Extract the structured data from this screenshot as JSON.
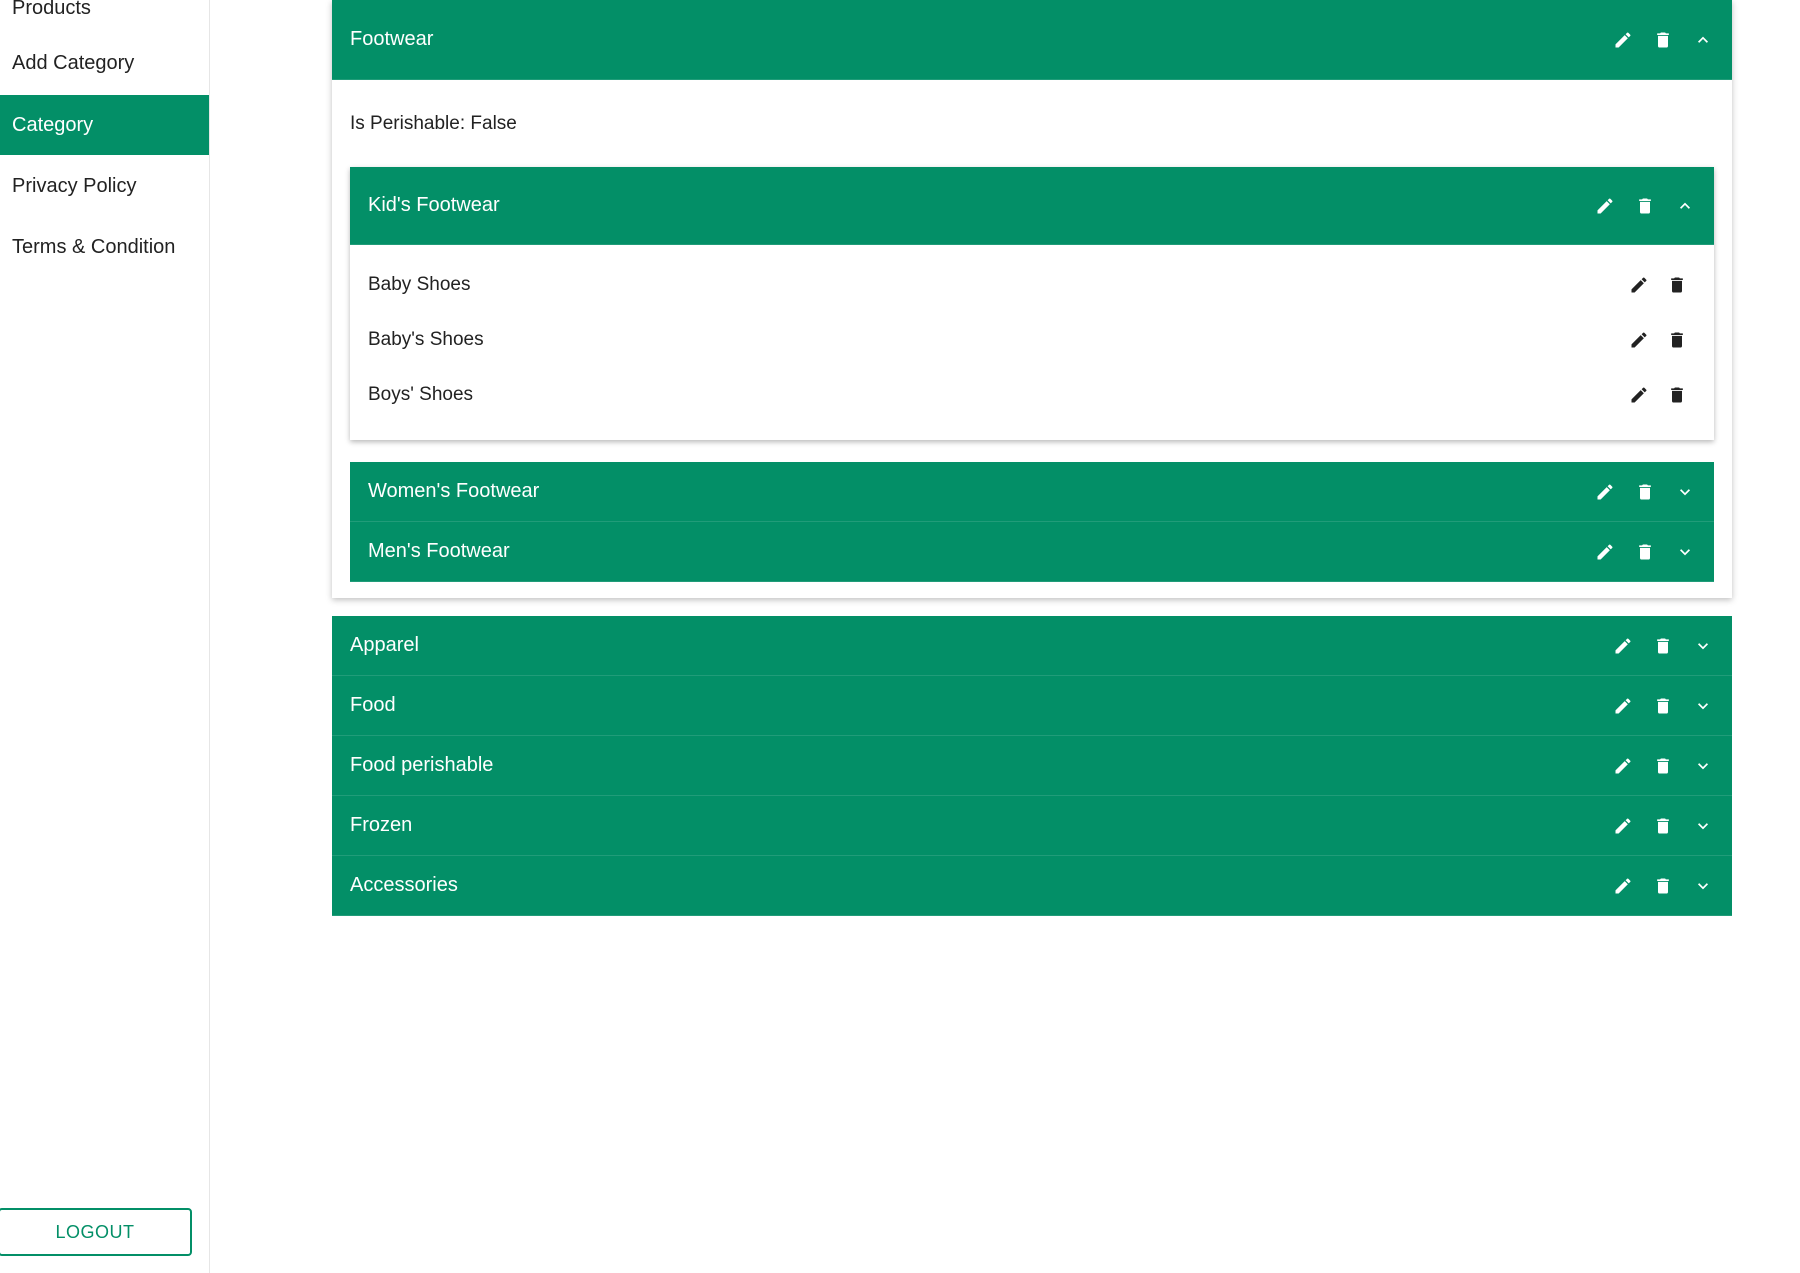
{
  "sidebar": {
    "items": [
      {
        "label": "Products",
        "active": false
      },
      {
        "label": "Add Category",
        "active": false
      },
      {
        "label": "Category",
        "active": true
      },
      {
        "label": "Privacy Policy",
        "active": false
      },
      {
        "label": "Terms & Condition",
        "active": false
      }
    ],
    "logout_label": "LOGOUT"
  },
  "categories": [
    {
      "name": "Footwear",
      "expanded": true,
      "perishable_text": "Is Perishable: False",
      "subcategories": [
        {
          "name": "Kid's Footwear",
          "expanded": true,
          "children": [
            "Baby Shoes",
            "Baby's Shoes",
            "Boys' Shoes"
          ]
        },
        {
          "name": "Women's Footwear",
          "expanded": false
        },
        {
          "name": "Men's Footwear",
          "expanded": false
        }
      ]
    },
    {
      "name": "Apparel",
      "expanded": false
    },
    {
      "name": "Food",
      "expanded": false
    },
    {
      "name": "Food perishable",
      "expanded": false
    },
    {
      "name": "Frozen",
      "expanded": false
    },
    {
      "name": "Accessories",
      "expanded": false
    }
  ],
  "icons": {
    "edit": "pencil-icon",
    "delete": "trash-icon",
    "expand": "chevron-down-icon",
    "collapse": "chevron-up-icon"
  },
  "colors": {
    "accent": "#038f67",
    "text": "#222222"
  }
}
